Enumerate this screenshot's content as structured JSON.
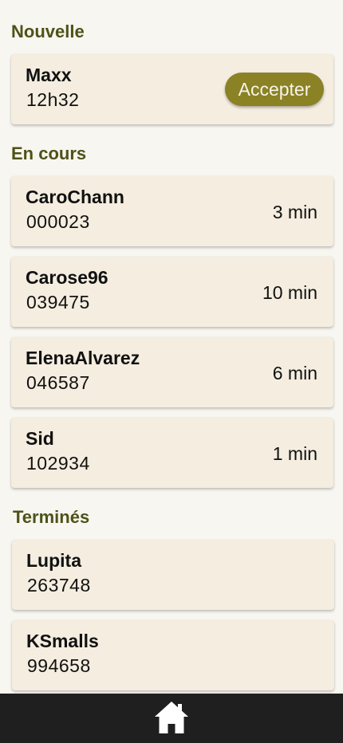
{
  "sections": {
    "new": {
      "title": "Nouvelle",
      "items": [
        {
          "name": "Maxx",
          "code": "12h32",
          "action_label": "Accepter"
        }
      ]
    },
    "in_progress": {
      "title": "En cours",
      "items": [
        {
          "name": "CaroChann",
          "code": "000023",
          "time": "3 min"
        },
        {
          "name": "Carose96",
          "code": "039475",
          "time": "10 min"
        },
        {
          "name": "ElenaAlvarez",
          "code": "046587",
          "time": "6 min"
        },
        {
          "name": "Sid",
          "code": "102934",
          "time": "1 min"
        }
      ]
    },
    "done": {
      "title": "Terminés",
      "items": [
        {
          "name": "Lupita",
          "code": "263748"
        },
        {
          "name": "KSmalls",
          "code": "994658"
        }
      ]
    }
  },
  "bottom_nav": {
    "home_icon": "home-icon"
  },
  "colors": {
    "accent": "#8a8224",
    "section_title": "#4e5218",
    "card_bg": "#f4ede0",
    "page_bg": "#f8f6f0",
    "nav_bg": "#1f1f1f"
  }
}
